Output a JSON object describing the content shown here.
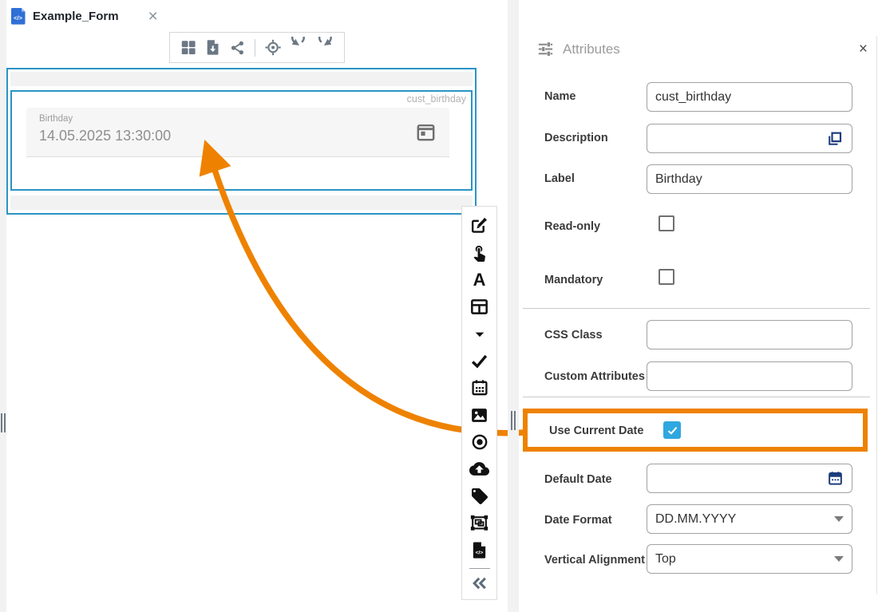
{
  "tab": {
    "title": "Example_Form",
    "close_glyph": "×"
  },
  "top_toolbar": {
    "icons": [
      "layout-grid-icon",
      "export-file-icon",
      "share-icon",
      "focus-target-icon",
      "undo-icon",
      "redo-icon"
    ]
  },
  "canvas": {
    "element_id": "cust_birthday",
    "field": {
      "label": "Birthday",
      "value": "14.05.2025 13:30:00",
      "icon": "calendar-icon"
    }
  },
  "element_toolbar": {
    "icons": [
      "edit-icon",
      "touch-icon",
      "text-icon",
      "table-icon",
      "caret-down-icon",
      "check-icon",
      "calendar-icon",
      "image-icon",
      "radio-icon",
      "cloud-upload-icon",
      "tag-icon",
      "object-group-icon",
      "code-file-icon",
      "collapse-left-icon"
    ],
    "text_icon_glyph": "A",
    "code_icon_glyph": "</>"
  },
  "panel": {
    "title": "Attributes",
    "close_glyph": "×",
    "fields": {
      "name": {
        "label": "Name",
        "value": "cust_birthday"
      },
      "description": {
        "label": "Description",
        "value": "",
        "trail_icon": "copy-icon"
      },
      "label": {
        "label": "Label",
        "value": "Birthday"
      },
      "read_only": {
        "label": "Read-only",
        "checked": false
      },
      "mandatory": {
        "label": "Mandatory",
        "checked": false
      },
      "css_class": {
        "label": "CSS Class",
        "value": ""
      },
      "custom_attributes": {
        "label": "Custom Attributes",
        "value": ""
      },
      "use_current_date": {
        "label": "Use Current Date",
        "checked": true
      },
      "default_date": {
        "label": "Default Date",
        "value": "",
        "trail_icon": "calendar-icon"
      },
      "date_format": {
        "label": "Date Format",
        "value": "DD.MM.YYYY"
      },
      "vertical_alignment": {
        "label": "Vertical Alignment",
        "value": "Top"
      }
    }
  },
  "colors": {
    "selection_blue": "#2b94c4",
    "highlight_orange": "#ee8200",
    "checkbox_blue": "#2fa7df",
    "action_icon_navy": "#1b3d7c",
    "toolbar_icon_gray": "#6b7884"
  }
}
